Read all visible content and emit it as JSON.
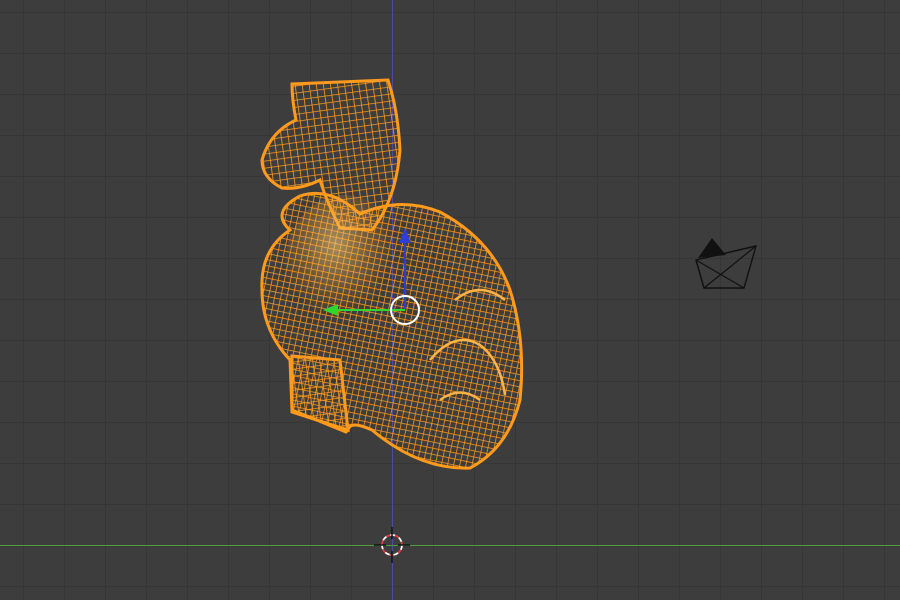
{
  "app": "3D viewport",
  "viewport": {
    "mode": "wireframe",
    "selected_object": "heart-mesh",
    "colors": {
      "background": "#3d3d3d",
      "grid": "#363636",
      "z_axis": "#4a4aa8",
      "y_axis": "#4e9e3a",
      "selection": "#ff9a1c",
      "selection_highlight": "#ffd27a",
      "gizmo_z": "#2f3fd6",
      "gizmo_y": "#2ed62e",
      "cursor_red": "#e23c3c",
      "camera_wire": "#111111"
    },
    "icons": [
      "3d-cursor-icon",
      "camera-icon",
      "transform-gizmo-icon"
    ]
  }
}
